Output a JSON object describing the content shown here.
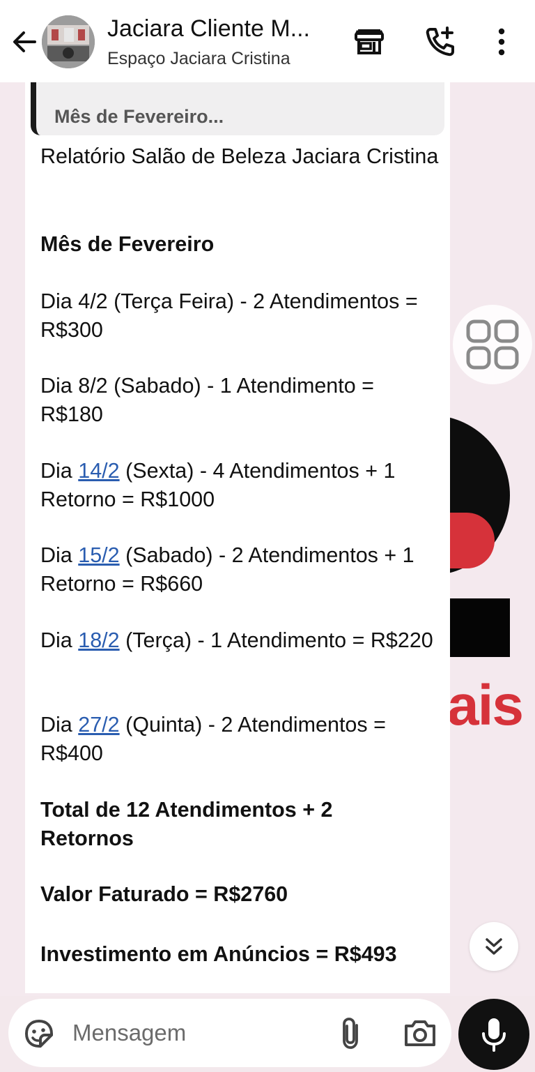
{
  "header": {
    "title": "Jaciara Cliente M...",
    "subtitle": "Espaço Jaciara Cristina",
    "icons": [
      "back-arrow-icon",
      "store-icon",
      "add-call-icon",
      "more-vertical-icon"
    ]
  },
  "quote": {
    "text": "Mês de Fevereiro..."
  },
  "message": {
    "title": "Relatório Salão de Beleza Jaciara Cristina",
    "month": "Mês de Fevereiro",
    "entries": [
      {
        "prefix": "Dia ",
        "date": "4/2",
        "date_is_link": false,
        "details": " (Terça Feira) -  2 Atendimentos = R$300"
      },
      {
        "prefix": "Dia ",
        "date": "8/2",
        "date_is_link": false,
        "details": " (Sabado) -  1 Atendimento = R$180"
      },
      {
        "prefix": "Dia ",
        "date": "14/2",
        "date_is_link": true,
        "details": " (Sexta) -  4 Atendimentos + 1 Retorno = R$1000"
      },
      {
        "prefix": "Dia ",
        "date": "15/2",
        "date_is_link": true,
        "details": " (Sabado) -  2 Atendimentos + 1 Retorno = R$660"
      },
      {
        "prefix": "Dia ",
        "date": "18/2",
        "date_is_link": true,
        "details": " (Terça) -  1 Atendimento = R$220"
      },
      {
        "prefix": "Dia ",
        "date": "27/2",
        "date_is_link": true,
        "details": " (Quinta) -  2 Atendimentos = R$400"
      }
    ],
    "total": "Total de 12 Atendimentos + 2 Retornos",
    "billed": "Valor Faturado  = R$2760",
    "ads": "Investimento em Anúncios = R$493"
  },
  "wallpaper": {
    "partial_text": "ais"
  },
  "composer": {
    "placeholder": "Mensagem",
    "icons": [
      "sticker-icon",
      "attach-icon",
      "camera-icon",
      "mic-icon"
    ]
  },
  "colors": {
    "link": "#2a5db0",
    "wallpaper": "#f4e9ee",
    "accent_red": "#d6323a"
  }
}
